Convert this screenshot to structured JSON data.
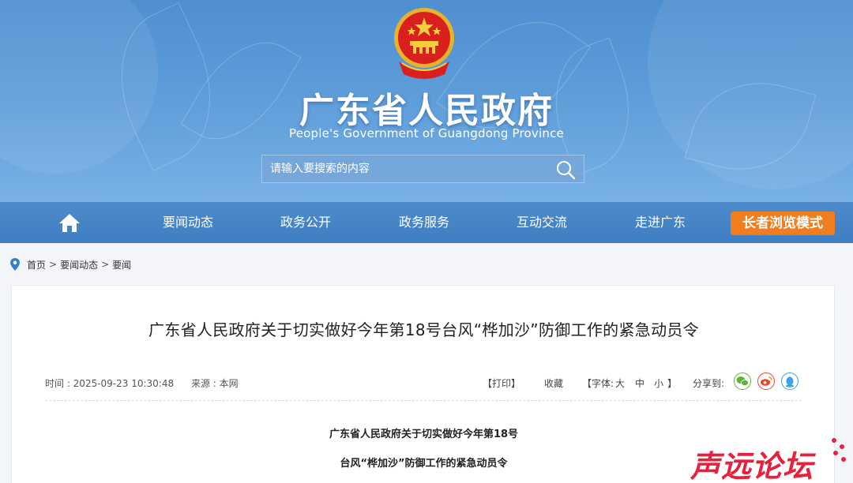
{
  "header": {
    "title": "广东省人民政府",
    "subtitle": "People's Government of Guangdong Province",
    "search_placeholder": "请输入要搜索的内容"
  },
  "nav": {
    "items": [
      "要闻动态",
      "政务公开",
      "政务服务",
      "互动交流",
      "走进广东"
    ],
    "elder_mode": "长者浏览模式"
  },
  "breadcrumb": [
    "首页",
    "要闻动态",
    "要闻"
  ],
  "article": {
    "title": "广东省人民政府关于切实做好今年第18号台风“桦加沙”防御工作的紧急动员令",
    "time": "时间 : 2025-09-23 10:30:48",
    "source": "来源 : 本网",
    "print": "【打印】",
    "favorite": "收藏",
    "font_open": "【字体:",
    "font_large": "大",
    "font_medium": "中",
    "font_small": "小",
    "font_close": "】",
    "share": "分享到:",
    "body_line1": "广东省人民政府关于切实做好今年第18号",
    "body_line2": "台风“桦加沙”防御工作的紧急动员令"
  },
  "watermark": "声远论坛",
  "colors": {
    "header_blue": "#5d9cd9",
    "nav_blue": "#4686c7",
    "elder_orange": "#f07d1e",
    "watermark_red": "#e8203c",
    "wechat_green": "#5bb53c",
    "weibo_red": "#e6452b",
    "qq_blue": "#3ca3e8"
  },
  "icons": [
    "national-emblem-icon",
    "search-icon",
    "home-icon",
    "location-pin-icon",
    "wechat-icon",
    "weibo-icon",
    "qq-icon"
  ]
}
